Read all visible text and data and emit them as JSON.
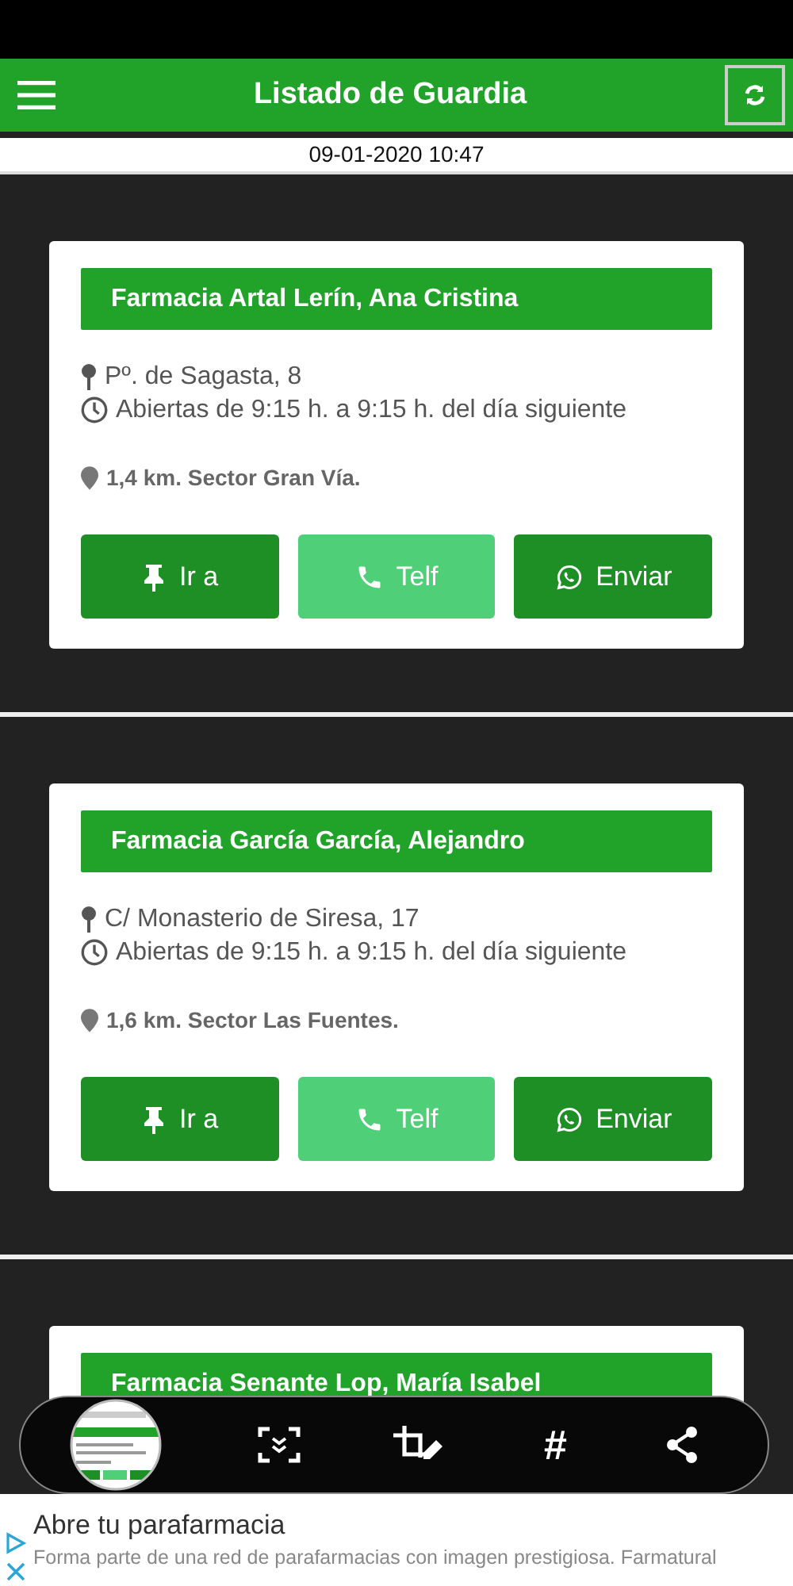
{
  "app_bar": {
    "title": "Listado de Guardia"
  },
  "timestamp": "09-01-2020 10:47",
  "pharmacies": [
    {
      "name": "Farmacia Artal Lerín, Ana Cristina",
      "address": "Pº. de Sagasta, 8",
      "hours": "Abiertas de 9:15 h. a 9:15 h. del día siguiente",
      "distance": "1,4 km. Sector Gran Vía.",
      "actions": [
        {
          "kind": "go",
          "label": "Ir a"
        },
        {
          "kind": "call",
          "label": "Telf"
        },
        {
          "kind": "send",
          "label": "Enviar"
        }
      ]
    },
    {
      "name": "Farmacia García García, Alejandro",
      "address": "C/ Monasterio de Siresa, 17",
      "hours": "Abiertas de 9:15 h. a 9:15 h. del día siguiente",
      "distance": "1,6 km. Sector Las Fuentes.",
      "actions": [
        {
          "kind": "go",
          "label": "Ir a"
        },
        {
          "kind": "call",
          "label": "Telf"
        },
        {
          "kind": "send",
          "label": "Enviar"
        }
      ]
    },
    {
      "name": "Farmacia Senante Lop, María Isabel"
    }
  ],
  "capture_toolbar": {
    "tools": [
      {
        "kind": "thumbnail"
      },
      {
        "kind": "scroll"
      },
      {
        "kind": "crop"
      },
      {
        "kind": "text",
        "label": "#"
      },
      {
        "kind": "share"
      }
    ]
  },
  "ad": {
    "title": "Abre tu parafarmacia",
    "text": "Forma parte de una red de parafarmacias con imagen prestigiosa. Farmatural"
  }
}
